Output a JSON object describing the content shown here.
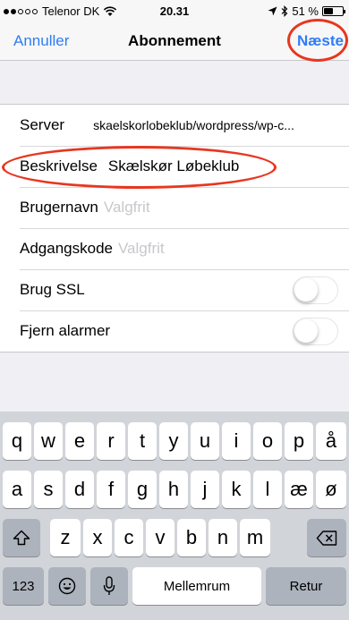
{
  "status_bar": {
    "carrier": "Telenor DK",
    "time": "20.31",
    "battery": "51 %",
    "battery_level": 0.51
  },
  "nav": {
    "cancel_label": "Annuller",
    "title": "Abonnement",
    "next_label": "Næste"
  },
  "form": {
    "server_label": "Server",
    "server_value": "skaelskorlobeklub/wordpress/wp-c...",
    "description_label": "Beskrivelse",
    "description_value": "Skælskør Løbeklub",
    "username_label": "Brugernavn",
    "username_placeholder": "Valgfrit",
    "password_label": "Adgangskode",
    "password_placeholder": "Valgfrit",
    "ssl_label": "Brug SSL",
    "ssl_on": false,
    "remove_alarms_label": "Fjern alarmer",
    "remove_alarms_on": false
  },
  "keyboard": {
    "row1": [
      "q",
      "w",
      "e",
      "r",
      "t",
      "y",
      "u",
      "i",
      "o",
      "p",
      "å"
    ],
    "row2": [
      "a",
      "s",
      "d",
      "f",
      "g",
      "h",
      "j",
      "k",
      "l",
      "æ",
      "ø"
    ],
    "row3": [
      "z",
      "x",
      "c",
      "v",
      "b",
      "n",
      "m"
    ],
    "numbers_label": "123",
    "space_label": "Mellemrum",
    "return_label": "Retur"
  },
  "colors": {
    "accent": "#2f7cf6",
    "annotation": "#e8361f"
  }
}
